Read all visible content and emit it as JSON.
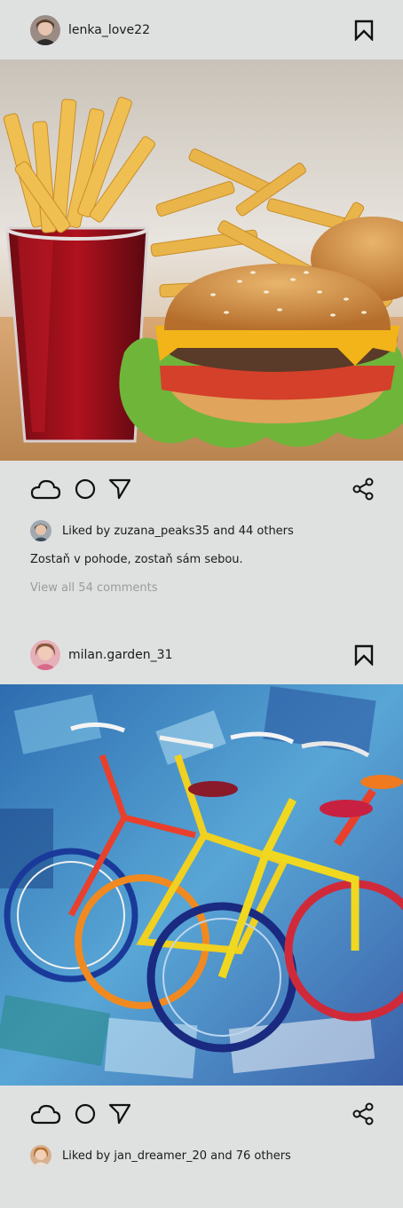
{
  "posts": [
    {
      "username": "lenka_love22",
      "avatar_icon": "user-avatar",
      "image_alt": "burger-fries-soda-photo",
      "liked_by_user": "zuzana_peaks35",
      "liked_text": "Liked by zuzana_peaks35 and 44 others",
      "caption": "Zostaň v pohode, zostaň sám sebou.",
      "comments_link": "View all 54 comments"
    },
    {
      "username": "milan.garden_31",
      "avatar_icon": "user-avatar",
      "image_alt": "bicycles-painting",
      "liked_by_user": "jan_dreamer_20",
      "liked_text": "Liked by jan_dreamer_20 and 76 others"
    }
  ],
  "icons": {
    "like": "cloud-icon",
    "comment": "circle-icon",
    "send": "send-icon",
    "share": "share-icon",
    "bookmark": "bookmark-icon"
  },
  "colors": {
    "background": "#dfe1e0",
    "text": "#1a1a1a",
    "muted": "#9a9c9c"
  }
}
